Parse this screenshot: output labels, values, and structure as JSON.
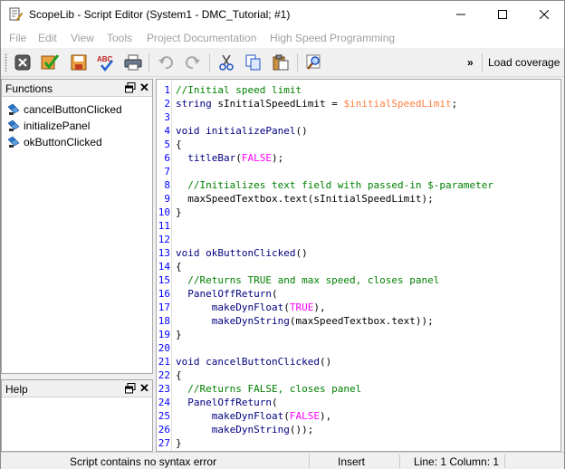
{
  "window": {
    "title": "ScopeLib - Script Editor (System1 - DMC_Tutorial; #1)"
  },
  "menu": {
    "items": [
      "File",
      "Edit",
      "View",
      "Tools",
      "Project Documentation",
      "High Speed Programming"
    ]
  },
  "toolbar": {
    "load_coverage_label": "Load coverage",
    "overflow_label": "»",
    "buttons": [
      "close-icon",
      "checkmark-icon",
      "save-icon",
      "spellcheck-icon",
      "print-icon",
      "undo-icon",
      "redo-icon",
      "cut-icon",
      "copy-icon",
      "paste-icon",
      "find-icon"
    ]
  },
  "functions_panel": {
    "title": "Functions",
    "items": [
      "cancelButtonClicked",
      "initializePanel",
      "okButtonClicked"
    ]
  },
  "help_panel": {
    "title": "Help"
  },
  "editor": {
    "lines": [
      {
        "n": "1",
        "tokens": [
          {
            "c": "t-com",
            "t": "//Initial speed limit"
          }
        ]
      },
      {
        "n": "2",
        "tokens": [
          {
            "c": "t-kw",
            "t": "string "
          },
          {
            "c": "t-txt",
            "t": "sInitialSpeedLimit = "
          },
          {
            "c": "t-var",
            "t": "$initialSpeedLimit"
          },
          {
            "c": "t-txt",
            "t": ";"
          }
        ]
      },
      {
        "n": "3",
        "tokens": []
      },
      {
        "n": "4",
        "tokens": [
          {
            "c": "t-kw",
            "t": "void "
          },
          {
            "c": "t-fn",
            "t": "initializePanel"
          },
          {
            "c": "t-txt",
            "t": "()"
          }
        ]
      },
      {
        "n": "5",
        "tokens": [
          {
            "c": "t-txt",
            "t": "{"
          }
        ]
      },
      {
        "n": "6",
        "tokens": [
          {
            "c": "t-fn",
            "t": "  titleBar"
          },
          {
            "c": "t-txt",
            "t": "("
          },
          {
            "c": "t-const",
            "t": "FALSE"
          },
          {
            "c": "t-txt",
            "t": ");"
          }
        ]
      },
      {
        "n": "7",
        "tokens": []
      },
      {
        "n": "8",
        "tokens": [
          {
            "c": "t-com",
            "t": "  //Initializes text field with passed-in $-parameter"
          }
        ]
      },
      {
        "n": "9",
        "tokens": [
          {
            "c": "t-txt",
            "t": "  maxSpeedTextbox.text(sInitialSpeedLimit);"
          }
        ]
      },
      {
        "n": "10",
        "tokens": [
          {
            "c": "t-txt",
            "t": "}"
          }
        ]
      },
      {
        "n": "11",
        "tokens": []
      },
      {
        "n": "12",
        "tokens": []
      },
      {
        "n": "13",
        "tokens": [
          {
            "c": "t-kw",
            "t": "void "
          },
          {
            "c": "t-fn",
            "t": "okButtonClicked"
          },
          {
            "c": "t-txt",
            "t": "()"
          }
        ]
      },
      {
        "n": "14",
        "tokens": [
          {
            "c": "t-txt",
            "t": "{"
          }
        ]
      },
      {
        "n": "15",
        "tokens": [
          {
            "c": "t-com",
            "t": "  //Returns TRUE and max speed, closes panel"
          }
        ]
      },
      {
        "n": "16",
        "tokens": [
          {
            "c": "t-fn",
            "t": "  PanelOffReturn"
          },
          {
            "c": "t-txt",
            "t": "("
          }
        ]
      },
      {
        "n": "17",
        "tokens": [
          {
            "c": "t-fn",
            "t": "      makeDynFloat"
          },
          {
            "c": "t-txt",
            "t": "("
          },
          {
            "c": "t-const",
            "t": "TRUE"
          },
          {
            "c": "t-txt",
            "t": "),"
          }
        ]
      },
      {
        "n": "18",
        "tokens": [
          {
            "c": "t-fn",
            "t": "      makeDynString"
          },
          {
            "c": "t-txt",
            "t": "(maxSpeedTextbox.text));"
          }
        ]
      },
      {
        "n": "19",
        "tokens": [
          {
            "c": "t-txt",
            "t": "}"
          }
        ]
      },
      {
        "n": "20",
        "tokens": []
      },
      {
        "n": "21",
        "tokens": [
          {
            "c": "t-kw",
            "t": "void "
          },
          {
            "c": "t-fn",
            "t": "cancelButtonClicked"
          },
          {
            "c": "t-txt",
            "t": "()"
          }
        ]
      },
      {
        "n": "22",
        "tokens": [
          {
            "c": "t-txt",
            "t": "{"
          }
        ]
      },
      {
        "n": "23",
        "tokens": [
          {
            "c": "t-com",
            "t": "  //Returns FALSE, closes panel"
          }
        ]
      },
      {
        "n": "24",
        "tokens": [
          {
            "c": "t-fn",
            "t": "  PanelOffReturn"
          },
          {
            "c": "t-txt",
            "t": "("
          }
        ]
      },
      {
        "n": "25",
        "tokens": [
          {
            "c": "t-fn",
            "t": "      makeDynFloat"
          },
          {
            "c": "t-txt",
            "t": "("
          },
          {
            "c": "t-const",
            "t": "FALSE"
          },
          {
            "c": "t-txt",
            "t": "),"
          }
        ]
      },
      {
        "n": "26",
        "tokens": [
          {
            "c": "t-fn",
            "t": "      makeDynString"
          },
          {
            "c": "t-txt",
            "t": "());"
          }
        ]
      },
      {
        "n": "27",
        "tokens": [
          {
            "c": "t-txt",
            "t": "}"
          }
        ]
      }
    ]
  },
  "status": {
    "message": "Script contains no syntax error",
    "mode": "Insert",
    "position": "Line: 1 Column: 1"
  },
  "colors": {
    "comment": "#008000",
    "keyword": "#000080",
    "dollar_var": "#ff8040",
    "constant": "#ff00ff",
    "line_number": "#0000ff"
  }
}
